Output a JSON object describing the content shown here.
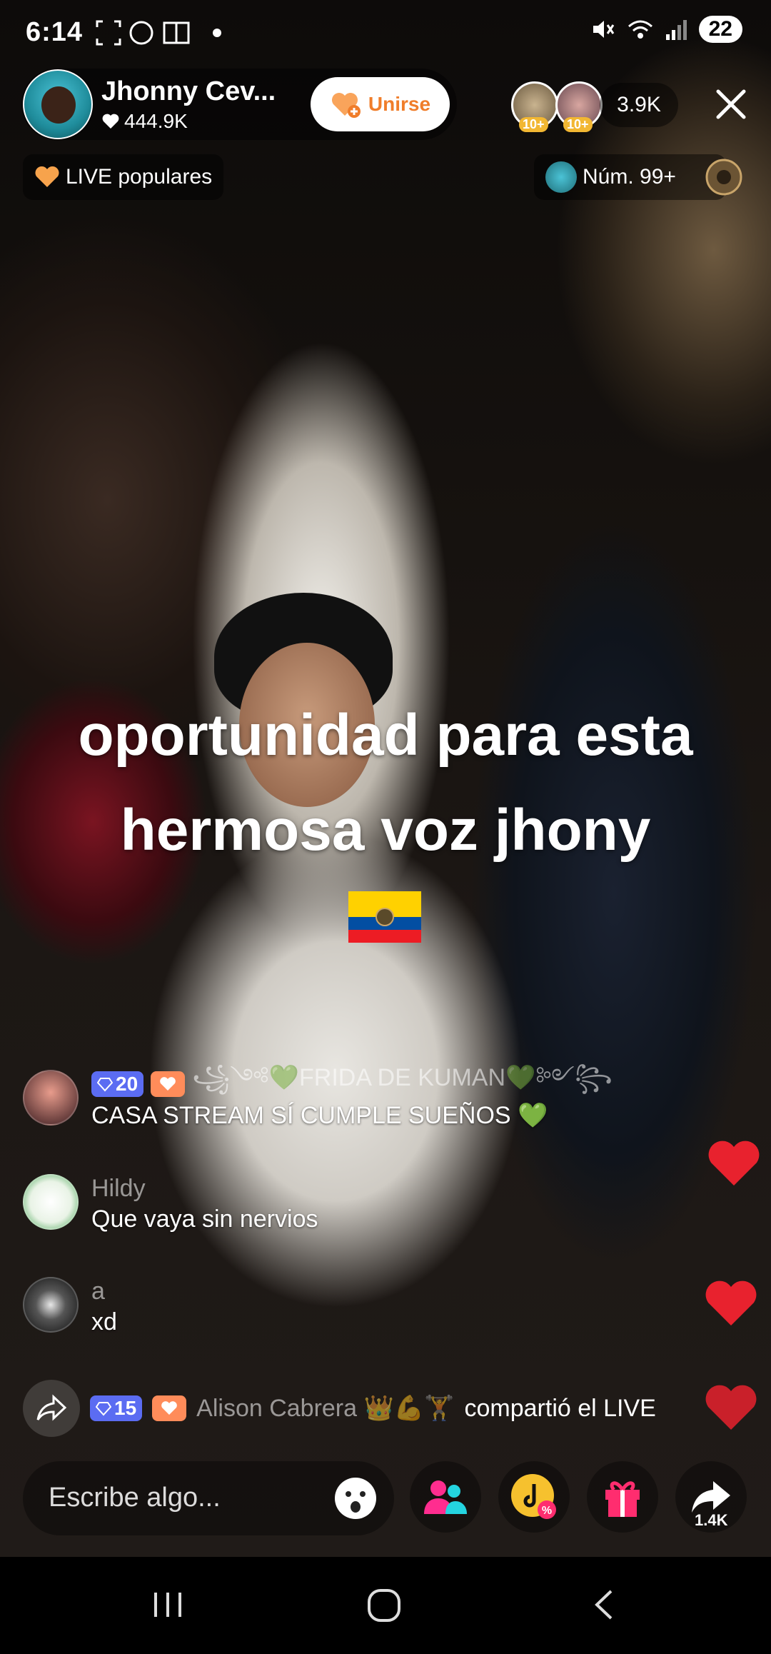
{
  "status_bar": {
    "time": "6:14",
    "battery": "22"
  },
  "host": {
    "name": "Jhonny Cev...",
    "likes": "444.9K",
    "join_label": "Unirse"
  },
  "viewers": {
    "badge_1": "10+",
    "badge_2": "10+",
    "count": "3.9K"
  },
  "tags": {
    "popular": "LIVE populares",
    "rank": "Núm. 99+"
  },
  "caption": {
    "line1": "oportunidad para esta",
    "line2": "hermosa voz jhony"
  },
  "comments": [
    {
      "level": "20",
      "username": "꧁༺💚FRIDA DE KUMAN💚༻꧂",
      "text": "CASA STREAM SÍ CUMPLE SUEÑOS 💚"
    },
    {
      "username": "Hildy",
      "text": "Que vaya sin nervios"
    },
    {
      "username": "a",
      "text": "xd"
    }
  ],
  "share_event": {
    "level": "15",
    "username": "Alison Cabrera 👑💪🏋",
    "text": "compartió el LIVE"
  },
  "input": {
    "placeholder": "Escribe algo..."
  },
  "actions": {
    "share_count": "1.4K"
  },
  "icons": [
    "fullscreen-icon",
    "whatsapp-icon",
    "book-icon",
    "mute-icon",
    "wifi-icon",
    "signal-icon",
    "heart-icon",
    "close-icon",
    "share-arrow-icon",
    "emoji-icon",
    "guests-icon",
    "coupon-icon",
    "gift-icon",
    "share-icon",
    "recents-icon",
    "home-icon",
    "back-icon"
  ],
  "colors": {
    "join": "#f07d2a",
    "gem": "#5b6cf2",
    "heart": "#e8222e",
    "gift": "#ff2d6f"
  }
}
